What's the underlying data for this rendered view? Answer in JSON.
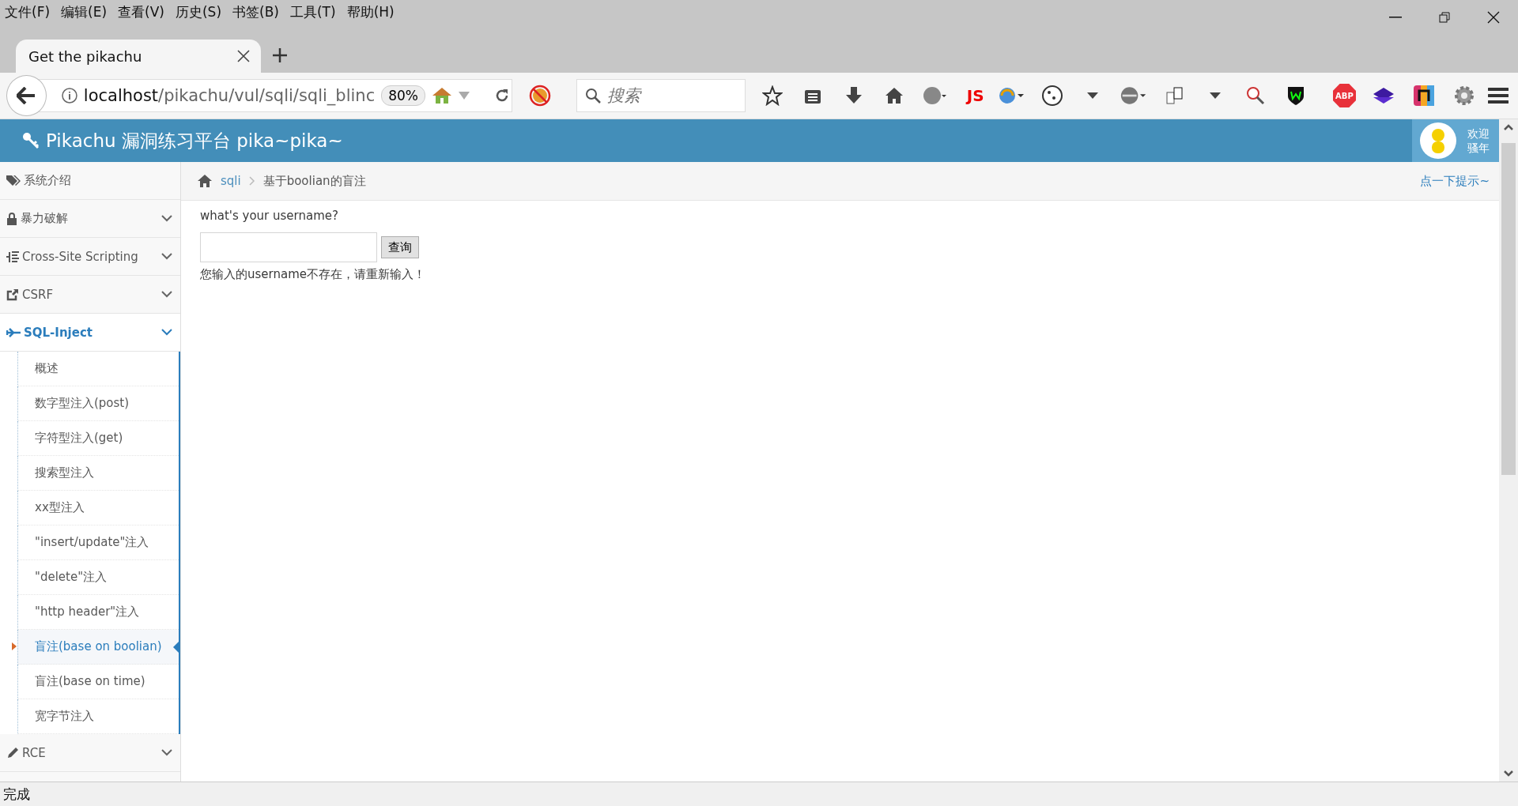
{
  "menu_bar": [
    "文件(F)",
    "编辑(E)",
    "查看(V)",
    "历史(S)",
    "书签(B)",
    "工具(T)",
    "帮助(H)"
  ],
  "tabs": [
    {
      "title": "Get the pikachu",
      "selected": true
    }
  ],
  "address_bar": {
    "host": "localhost",
    "path": "/pikachu/vul/sqli/sqli_blinc",
    "zoom": "80%"
  },
  "search_field": {
    "placeholder": "搜索"
  },
  "toolbar_texts": {
    "js": "JS",
    "abp": "ABP"
  },
  "header": {
    "title": "Pikachu 漏洞练习平台 pika~pika~",
    "greeting": "欢迎",
    "user": "骚年"
  },
  "sidebar": {
    "items": [
      {
        "label": "系统介绍",
        "kind": "link",
        "selected": false
      },
      {
        "label": "暴力破解",
        "kind": "group",
        "selected": false
      },
      {
        "label": "Cross-Site Scripting",
        "kind": "group",
        "selected": false
      },
      {
        "label": "CSRF",
        "kind": "group",
        "selected": false
      },
      {
        "label": "SQL-Inject",
        "kind": "group",
        "selected": true,
        "expanded": true,
        "children": [
          {
            "label": "概述",
            "selected": false
          },
          {
            "label": "数字型注入(post)",
            "selected": false
          },
          {
            "label": "字符型注入(get)",
            "selected": false
          },
          {
            "label": "搜索型注入",
            "selected": false
          },
          {
            "label": "xx型注入",
            "selected": false
          },
          {
            "label": "\"insert/update\"注入",
            "selected": false
          },
          {
            "label": "\"delete\"注入",
            "selected": false
          },
          {
            "label": "\"http header\"注入",
            "selected": false
          },
          {
            "label": "盲注(base on boolian)",
            "selected": true
          },
          {
            "label": "盲注(base on time)",
            "selected": false
          },
          {
            "label": "宽字节注入",
            "selected": false
          }
        ]
      },
      {
        "label": "RCE",
        "kind": "group",
        "selected": false
      }
    ]
  },
  "breadcrumb": {
    "parent": "sqli",
    "current": "基于boolian的盲注",
    "hint_link": "点一下提示~"
  },
  "form": {
    "question": "what's your username?",
    "button": "查询",
    "message": "您输入的username不存在，请重新输入！"
  },
  "status_bar": {
    "text": "完成"
  }
}
